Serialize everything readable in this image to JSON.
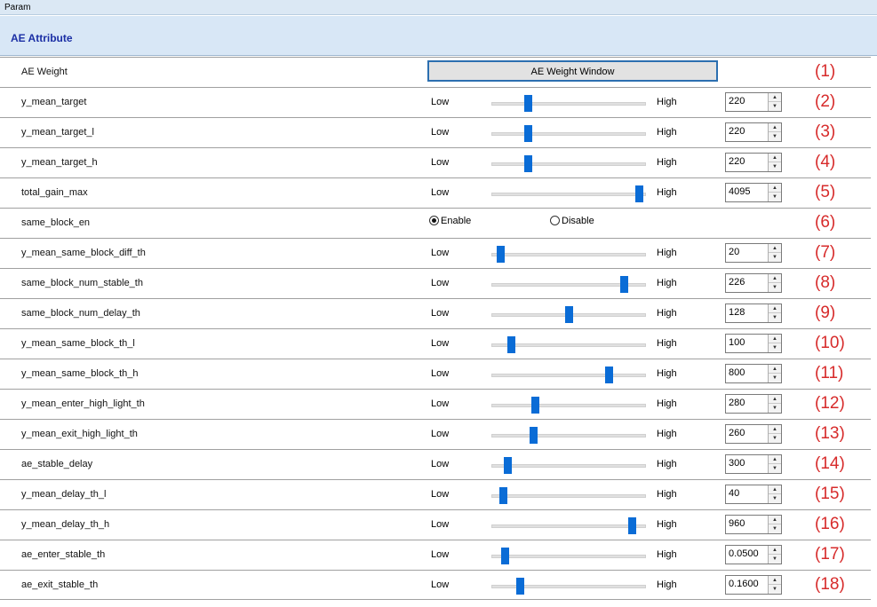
{
  "header": {
    "panel_title": "Param",
    "section_title": "AE Attribute"
  },
  "ae_weight": {
    "label": "AE Weight",
    "button_label": "AE Weight Window",
    "annotation": "(1)"
  },
  "slider_labels": {
    "low": "Low",
    "high": "High"
  },
  "same_block": {
    "label": "same_block_en",
    "enable_label": "Enable",
    "disable_label": "Disable",
    "selected": "Enable",
    "annotation": "(6)"
  },
  "params": [
    {
      "label": "y_mean_target",
      "value": "220",
      "level": 0.23,
      "annotation": "(2)"
    },
    {
      "label": "y_mean_target_l",
      "value": "220",
      "level": 0.23,
      "annotation": "(3)"
    },
    {
      "label": "y_mean_target_h",
      "value": "220",
      "level": 0.23,
      "annotation": "(4)"
    },
    {
      "label": "total_gain_max",
      "value": "4095",
      "level": 0.96,
      "annotation": "(5)"
    },
    {
      "label": "y_mean_same_block_diff_th",
      "value": "20",
      "level": 0.05,
      "annotation": "(7)"
    },
    {
      "label": "same_block_num_stable_th",
      "value": "226",
      "level": 0.86,
      "annotation": "(8)"
    },
    {
      "label": "same_block_num_delay_th",
      "value": "128",
      "level": 0.5,
      "annotation": "(9)"
    },
    {
      "label": "y_mean_same_block_th_l",
      "value": "100",
      "level": 0.12,
      "annotation": "(10)"
    },
    {
      "label": "y_mean_same_block_th_h",
      "value": "800",
      "level": 0.76,
      "annotation": "(11)"
    },
    {
      "label": "y_mean_enter_high_light_th",
      "value": "280",
      "level": 0.28,
      "annotation": "(12)"
    },
    {
      "label": "y_mean_exit_high_light_th",
      "value": "260",
      "level": 0.27,
      "annotation": "(13)"
    },
    {
      "label": "ae_stable_delay",
      "value": "300",
      "level": 0.1,
      "annotation": "(14)"
    },
    {
      "label": "y_mean_delay_th_l",
      "value": "40",
      "level": 0.07,
      "annotation": "(15)"
    },
    {
      "label": "y_mean_delay_th_h",
      "value": "960",
      "level": 0.91,
      "annotation": "(16)"
    },
    {
      "label": "ae_enter_stable_th",
      "value": "0.0500",
      "level": 0.08,
      "annotation": "(17)"
    },
    {
      "label": "ae_exit_stable_th",
      "value": "0.1600",
      "level": 0.18,
      "annotation": "(18)"
    }
  ],
  "colors": {
    "accent": "#0a6cd6",
    "annotation": "#d72b2b",
    "section_title": "#1b2fa5"
  }
}
